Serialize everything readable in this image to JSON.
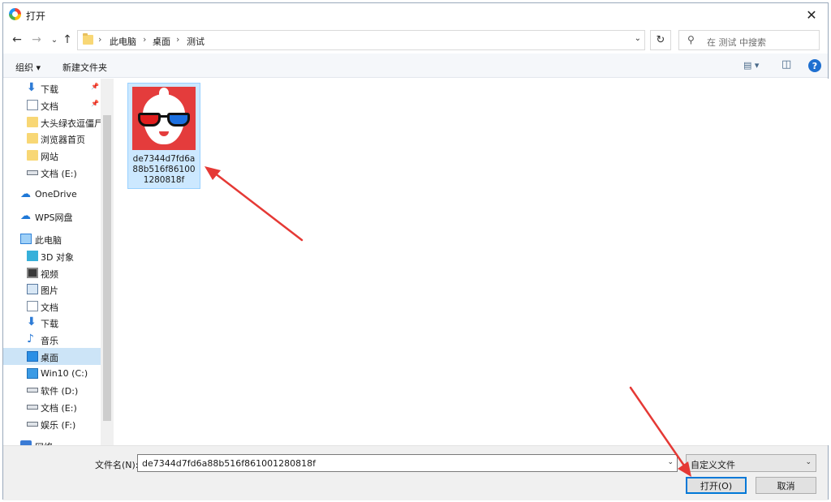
{
  "window": {
    "title": "打开",
    "close_glyph": "✕"
  },
  "nav": {
    "back": "←",
    "forward": "→",
    "recent": "⌄",
    "up": "↑",
    "breadcrumbs": [
      "此电脑",
      "桌面",
      "测试"
    ],
    "crumb_separator": "›",
    "address_dropdown": "⌄",
    "refresh": "↻",
    "search_placeholder": "在 测试 中搜索",
    "search_glyph": "⚲"
  },
  "toolbar": {
    "organize": "组织 ▾",
    "new_folder": "新建文件夹",
    "view_glyph": "▤ ▾",
    "pane_glyph": "◫",
    "help": "?"
  },
  "sidebar": {
    "items": [
      {
        "label": "下载",
        "icon": "download-icon",
        "pinned": true
      },
      {
        "label": "文档",
        "icon": "document-icon",
        "pinned": true
      },
      {
        "label": "大头绿衣逗僵尸",
        "icon": "folder-icon"
      },
      {
        "label": "浏览器首页",
        "icon": "folder-icon"
      },
      {
        "label": "网站",
        "icon": "folder-icon"
      },
      {
        "label": "文档 (E:)",
        "icon": "drive-icon"
      },
      {
        "label": "OneDrive",
        "icon": "cloud-icon"
      },
      {
        "label": "WPS网盘",
        "icon": "cloud-icon"
      },
      {
        "label": "此电脑",
        "icon": "computer-icon"
      },
      {
        "label": "3D 对象",
        "icon": "3d-objects-icon"
      },
      {
        "label": "视频",
        "icon": "video-icon"
      },
      {
        "label": "图片",
        "icon": "picture-icon"
      },
      {
        "label": "文档",
        "icon": "document-icon"
      },
      {
        "label": "下载",
        "icon": "download-icon"
      },
      {
        "label": "音乐",
        "icon": "music-icon"
      },
      {
        "label": "桌面",
        "icon": "desktop-icon",
        "selected": true
      },
      {
        "label": "Win10 (C:)",
        "icon": "windows-drive-icon"
      },
      {
        "label": "软件 (D:)",
        "icon": "drive-icon"
      },
      {
        "label": "文档 (E:)",
        "icon": "drive-icon"
      },
      {
        "label": "娱乐 (F:)",
        "icon": "drive-icon"
      },
      {
        "label": "网络",
        "icon": "network-icon"
      }
    ],
    "pin_glyph": "📌"
  },
  "files": [
    {
      "name": "de7344d7fd6a88b516f861001280818f",
      "selected": true
    }
  ],
  "bottom": {
    "filename_label": "文件名(N):",
    "filename_value": "de7344d7fd6a88b516f861001280818f",
    "filetype_value": "自定义文件",
    "dropdown_glyph": "⌄",
    "open_button": "打开(O)",
    "cancel_button": "取消"
  },
  "colors": {
    "selection": "#cce8ff",
    "accent": "#0078d7",
    "arrow": "#e53935"
  }
}
